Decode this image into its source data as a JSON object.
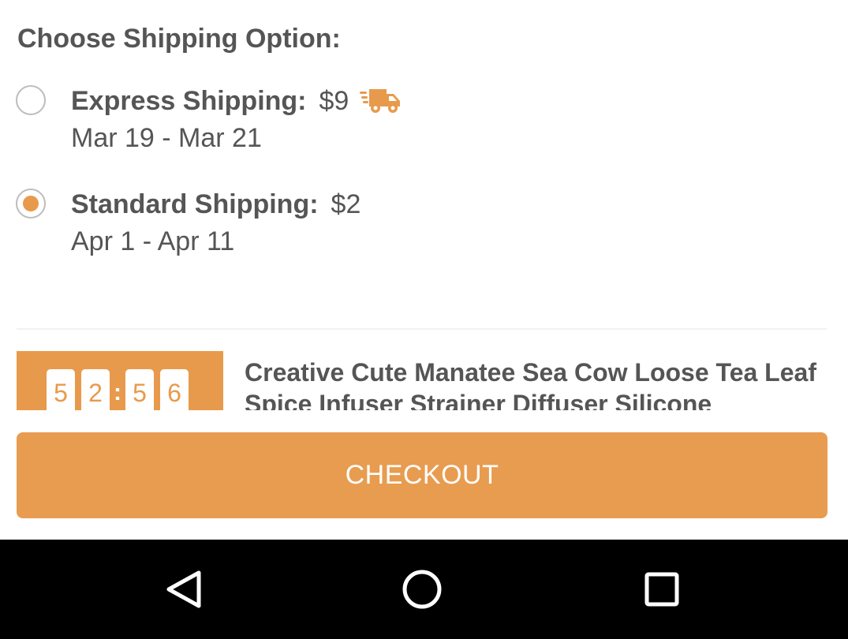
{
  "shipping": {
    "title": "Choose Shipping Option:",
    "options": [
      {
        "name": "Express Shipping:",
        "price": "$9",
        "dates": "Mar 19 - Mar 21",
        "selected": false,
        "icon": "delivery-truck-icon"
      },
      {
        "name": "Standard Shipping:",
        "price": "$2",
        "dates": "Apr 1 - Apr 11",
        "selected": true
      }
    ]
  },
  "product": {
    "timer_digits": [
      "5",
      "2",
      "5",
      "6"
    ],
    "timer_separator": ":",
    "title": "Creative Cute Manatee Sea Cow Loose Tea Leaf Spice Infuser Strainer Diffuser Silicone"
  },
  "checkout": {
    "label": "CHECKOUT"
  },
  "navbar": {
    "icons": [
      "back-icon",
      "home-icon",
      "recents-icon"
    ]
  },
  "colors": {
    "accent": "#e89a4c",
    "text": "#555555",
    "navbar": "#000000"
  }
}
